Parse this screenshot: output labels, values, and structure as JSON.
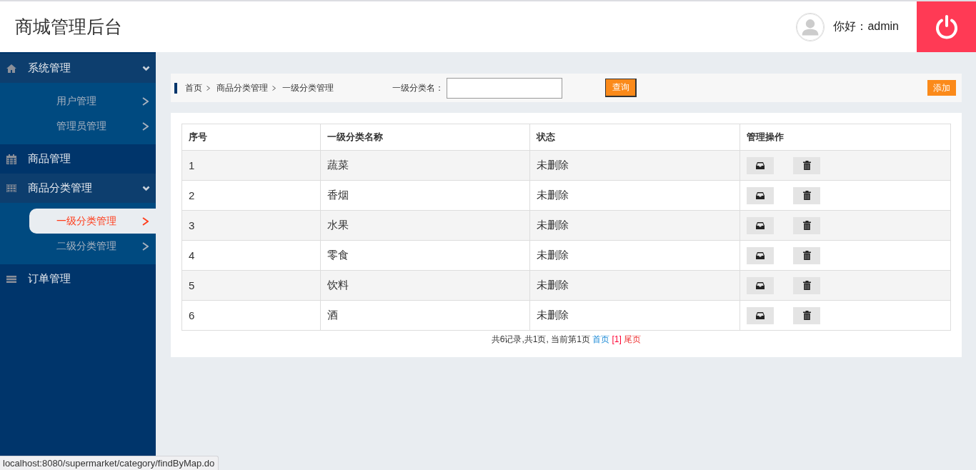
{
  "header": {
    "title": "商城管理后台",
    "greeting": "你好：admin"
  },
  "sidebar": {
    "groups": [
      {
        "label": "系统管理",
        "kind": "home",
        "expanded": true,
        "children": [
          {
            "label": "用户管理",
            "selected": false
          },
          {
            "label": "管理员管理",
            "selected": false
          }
        ]
      },
      {
        "label": "商品管理",
        "kind": "calendar",
        "expanded": false
      },
      {
        "label": "商品分类管理",
        "kind": "grid",
        "expanded": true,
        "children": [
          {
            "label": "一级分类管理",
            "selected": true
          },
          {
            "label": "二级分类管理",
            "selected": false
          }
        ]
      },
      {
        "label": "订单管理",
        "kind": "list",
        "expanded": false
      }
    ]
  },
  "breadcrumb": [
    "首页",
    "商品分类管理",
    "一级分类管理"
  ],
  "search": {
    "label": "一级分类名：",
    "button": "查询"
  },
  "add_button": "添加",
  "table": {
    "columns": [
      "序号",
      "一级分类名称",
      "状态",
      "管理操作"
    ],
    "rows": [
      {
        "index": "1",
        "name": "蔬菜",
        "status": "未删除"
      },
      {
        "index": "2",
        "name": "香烟",
        "status": "未删除"
      },
      {
        "index": "3",
        "name": "水果",
        "status": "未删除"
      },
      {
        "index": "4",
        "name": "零食",
        "status": "未删除"
      },
      {
        "index": "5",
        "name": "饮料",
        "status": "未删除"
      },
      {
        "index": "6",
        "name": "酒",
        "status": "未删除"
      }
    ]
  },
  "pagination": {
    "summary": "共6记录,共1页, 当前第1页",
    "first": "首页",
    "current": "[1]",
    "last": "尾页"
  },
  "status_bar": "localhost:8080/supermarket/category/findByMap.do"
}
